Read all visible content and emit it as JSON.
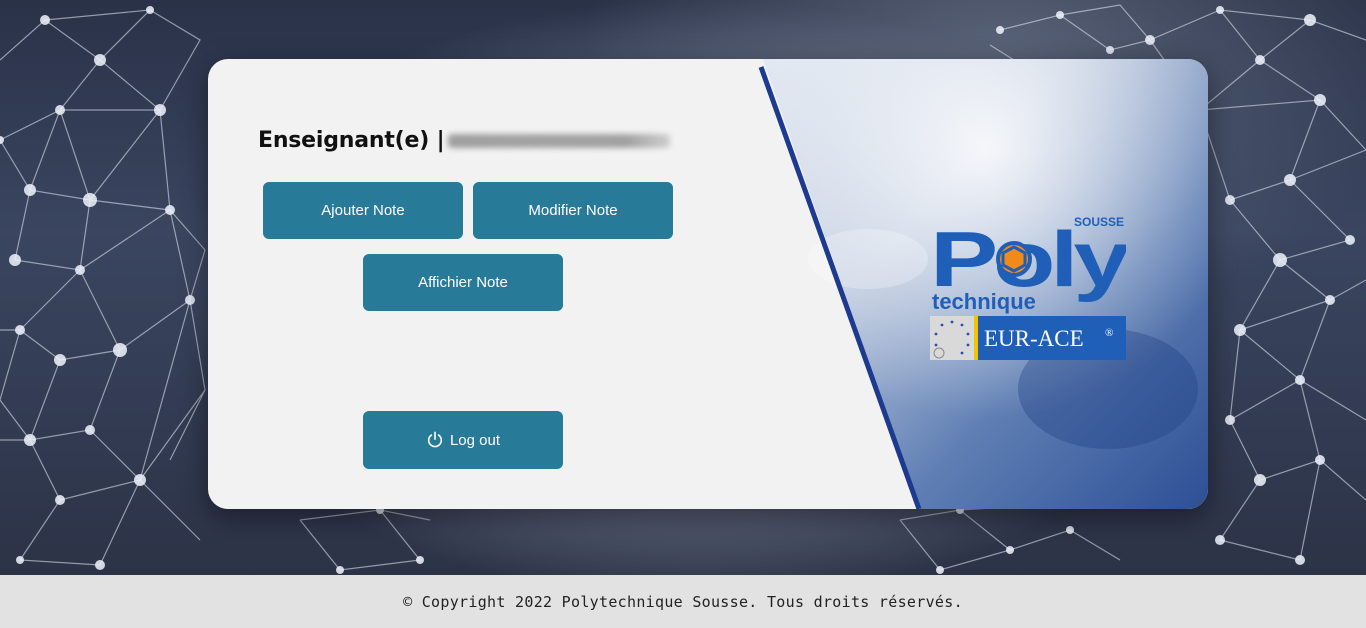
{
  "header": {
    "role_label": "Enseignant(e) |"
  },
  "actions": {
    "add_label": "Ajouter Note",
    "edit_label": "Modifier Note",
    "show_label": "Affichier Note",
    "logout_label": "Log out"
  },
  "logo": {
    "brand_top": "SOUSSE",
    "brand_main": "Poly",
    "brand_sub": "technique",
    "accreditation": "EUR-ACE",
    "accreditation_mark": "®"
  },
  "footer": {
    "copyright": "© Copyright 2022 Polytechnique Sousse. Tous droits réservés."
  },
  "colors": {
    "button": "#287a99",
    "card": "#f2f2f2",
    "logo_blue": "#1f5fb8",
    "logo_orange": "#f28a1a",
    "divider": "#1c3a8f"
  },
  "icons": {
    "logout": "power-icon"
  }
}
